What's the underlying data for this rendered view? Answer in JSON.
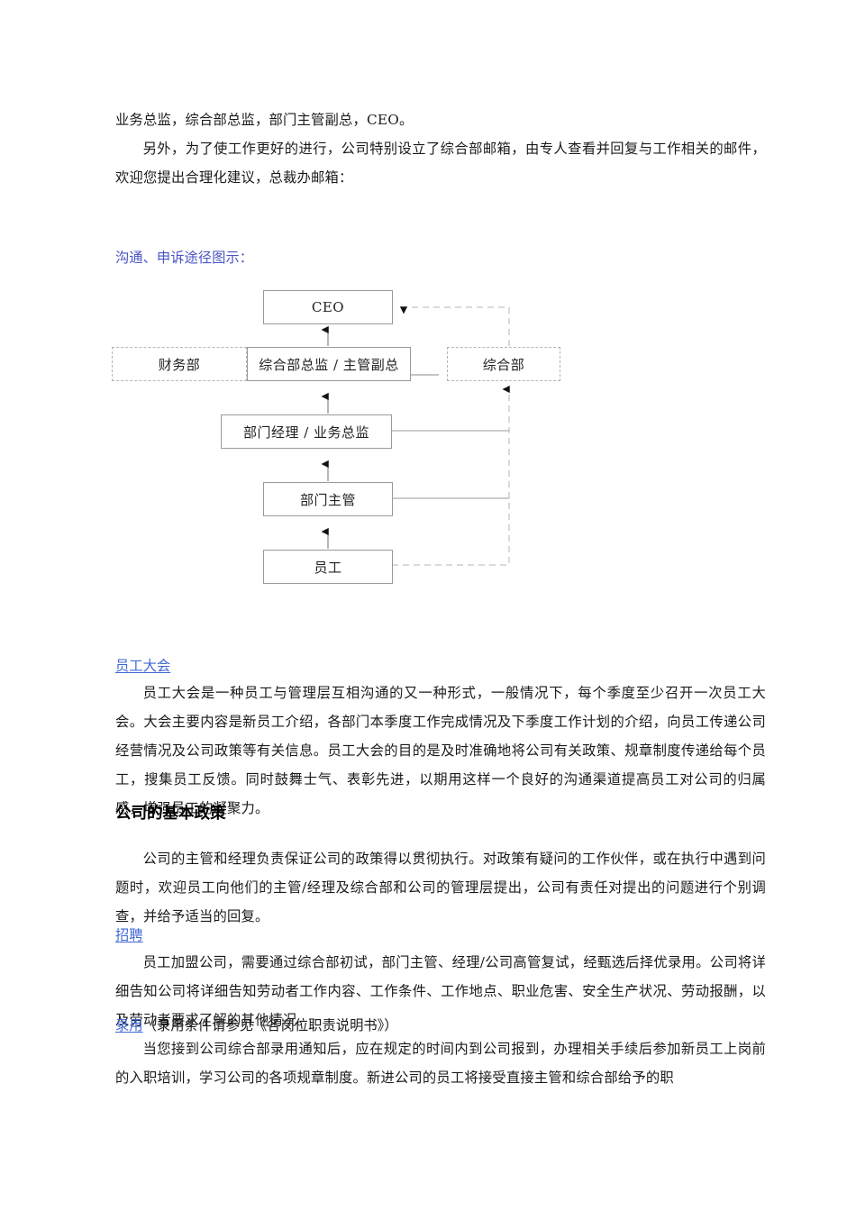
{
  "document": {
    "top_paragraphs": [
      "业务总监，综合部总监，部门主管副总，CEO。",
      "另外，为了使工作更好的进行，公司特别设立了综合部邮箱，由专人查看并回复与工作相关的邮件，欢迎您提出合理化建议，总裁办邮箱："
    ],
    "diagram_heading": "沟通、申诉途径图示：",
    "sections": [
      {
        "heading": "员工大会",
        "body": "员工大会是一种员工与管理层互相沟通的又一种形式，一般情况下，每个季度至少召开一次员工大会。大会主要内容是新员工介绍，各部门本季度工作完成情况及下季度工作计划的介绍，向员工传递公司经营情况及公司政策等有关信息。员工大会的目的是及时准确地将公司有关政策、规章制度传递给每个员工，搜集员工反馈。同时鼓舞士气、表彰先进，以期用这样一个良好的沟通渠道提高员工对公司的归属感，增强员工的凝聚力。"
      }
    ],
    "policy_heading": "公司的基本政策",
    "policy_body": "公司的主管和经理负责保证公司的政策得以贯彻执行。对政策有疑问的工作伙伴，或在执行中遇到问题时，欢迎员工向他们的主管/经理及综合部和公司的管理层提出，公司有责任对提出的问题进行个别调查，并给予适当的回复。",
    "recruit_heading": "招聘",
    "recruit_body": "员工加盟公司，需要通过综合部初试，部门主管、经理/公司高管复试，经甄选后择优录用。公司将详细告知公司将详细告知劳动者工作内容、工作条件、工作地点、职业危害、安全生产状况、劳动报酬，以及劳动者要求了解的其他情况。",
    "hire_heading": "录用",
    "hire_heading_suffix": "（录用条件请参见《各岗位职责说明书》）",
    "hire_body": "当您接到公司综合部录用通知后，应在规定的时间内到公司报到，办理相关手续后参加新员工上岗前的入职培训，学习公司的各项规章制度。新进公司的员工将接受直接主管和综合部给予的职"
  },
  "diagram": {
    "nodes": [
      {
        "id": "ceo",
        "label": "CEO",
        "style": "solid"
      },
      {
        "id": "finance",
        "label": "财务部",
        "style": "dashed"
      },
      {
        "id": "gm-director",
        "label": "综合部总监 / 主管副总",
        "style": "solid"
      },
      {
        "id": "general-dept",
        "label": "综合部",
        "style": "dashed"
      },
      {
        "id": "dept-manager",
        "label": "部门经理 / 业务总监",
        "style": "solid"
      },
      {
        "id": "dept-supervisor",
        "label": "部门主管",
        "style": "solid"
      },
      {
        "id": "employee",
        "label": "员工",
        "style": "solid"
      }
    ]
  },
  "colors": {
    "heading_blue": "#4A55C4",
    "link_blue": "#4169d8",
    "box_border": "#9a9a9a",
    "dashed_border": "#b6b6b6",
    "text": "#1a1a1a"
  }
}
